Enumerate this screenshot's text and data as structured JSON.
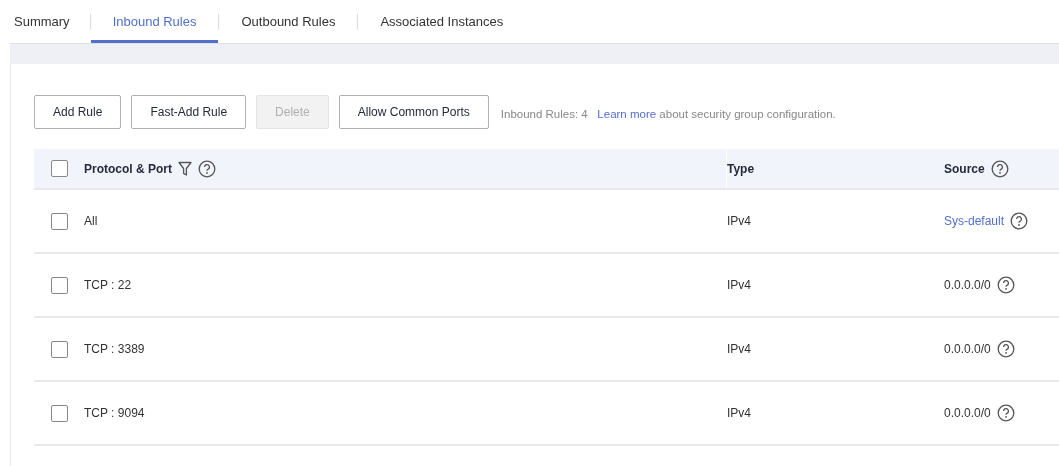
{
  "tabs": [
    {
      "label": "Summary",
      "selected": false
    },
    {
      "label": "Inbound Rules",
      "selected": true
    },
    {
      "label": "Outbound Rules",
      "selected": false
    },
    {
      "label": "Associated Instances",
      "selected": false
    }
  ],
  "toolbar": {
    "buttons": [
      {
        "label": "Add Rule",
        "disabled": false
      },
      {
        "label": "Fast-Add Rule",
        "disabled": false
      },
      {
        "label": "Delete",
        "disabled": true
      },
      {
        "label": "Allow Common Ports",
        "disabled": false
      }
    ],
    "count": "Inbound Rules: 4",
    "link": "Learn more",
    "note": "about security group configuration."
  },
  "table": {
    "header": {
      "checked": false
    },
    "columns": [
      "Protocol & Port",
      "Type",
      "Source"
    ],
    "rows": [
      {
        "checked": false,
        "protocol_port": "All",
        "type": "IPv4",
        "source": "Sys-default",
        "kind": "link"
      },
      {
        "checked": false,
        "protocol_port": "TCP : 22",
        "type": "IPv4",
        "source": "0.0.0.0/0",
        "kind": "text"
      },
      {
        "checked": false,
        "protocol_port": "TCP : 3389",
        "type": "IPv4",
        "source": "0.0.0.0/0",
        "kind": "text"
      },
      {
        "checked": false,
        "protocol_port": "TCP : 9094",
        "type": "IPv4",
        "source": "0.0.0.0/0",
        "kind": "text"
      }
    ]
  }
}
